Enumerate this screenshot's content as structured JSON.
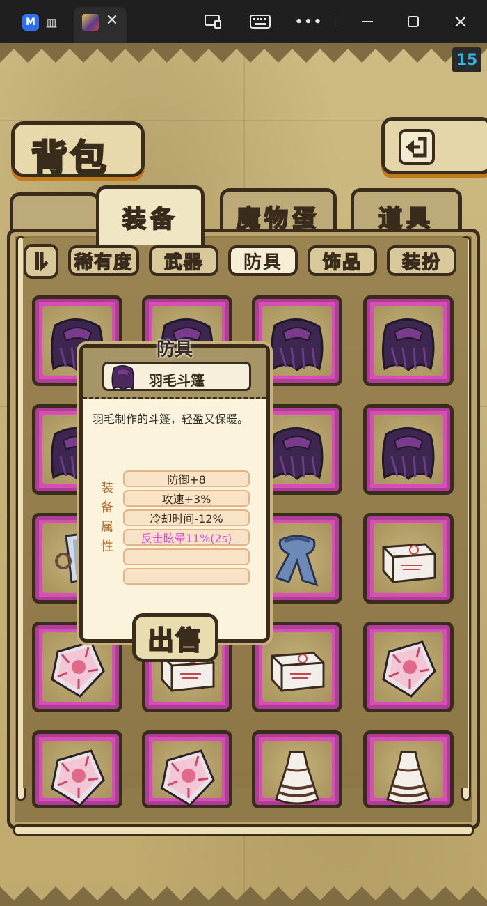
{
  "window": {
    "app_tab_title": "皿",
    "app_logo": "M",
    "close_label": "✕",
    "buttons": [
      "screen-share-icon",
      "keyboard-icon",
      "more-icon",
      "minimize-icon",
      "maximize-icon",
      "close-icon"
    ]
  },
  "hud": {
    "fps": "15"
  },
  "header": {
    "title": "背包"
  },
  "categories": [
    {
      "label": "装备",
      "active": true
    },
    {
      "label": "魔物蛋",
      "active": false
    },
    {
      "label": "道具",
      "active": false
    }
  ],
  "filters": [
    {
      "label": "稀有度",
      "active": false
    },
    {
      "label": "武器",
      "active": false
    },
    {
      "label": "防具",
      "active": true
    },
    {
      "label": "饰品",
      "active": false
    },
    {
      "label": "装扮",
      "active": false
    }
  ],
  "grid": {
    "rows": [
      [
        "feather-cloak-icon",
        "feather-cloak-icon",
        "feather-cloak-icon",
        "feather-cloak-icon"
      ],
      [
        "feather-cloak-icon",
        "feather-cloak-icon",
        "feather-cloak-icon",
        "feather-cloak-icon"
      ],
      [
        "crystal-bracer-icon",
        "blue-scarf-icon",
        "blue-scarf-icon",
        "supply-box-icon"
      ],
      [
        "pink-shield-icon",
        "supply-box-icon",
        "supply-box-icon",
        "pink-shield-icon"
      ],
      [
        "pink-shield-icon",
        "pink-shield-icon",
        "lace-dress-icon",
        "lace-dress-icon"
      ]
    ]
  },
  "popup": {
    "category": "防具",
    "item_name": "羽毛斗篷",
    "description": "羽毛制作的斗篷，轻盈又保暖。",
    "attr_label": "装备属性",
    "attributes": [
      "防御+8",
      "攻速+3%",
      "冷却时间-12%",
      "反击眩晕11%(2s)",
      "",
      ""
    ],
    "sell_label": "出售"
  },
  "colors": {
    "slot_border": "#d64fb7",
    "frame_dark": "#3a2c1d",
    "parchment": "#c9b67e",
    "special_attr": "#e04adb"
  }
}
